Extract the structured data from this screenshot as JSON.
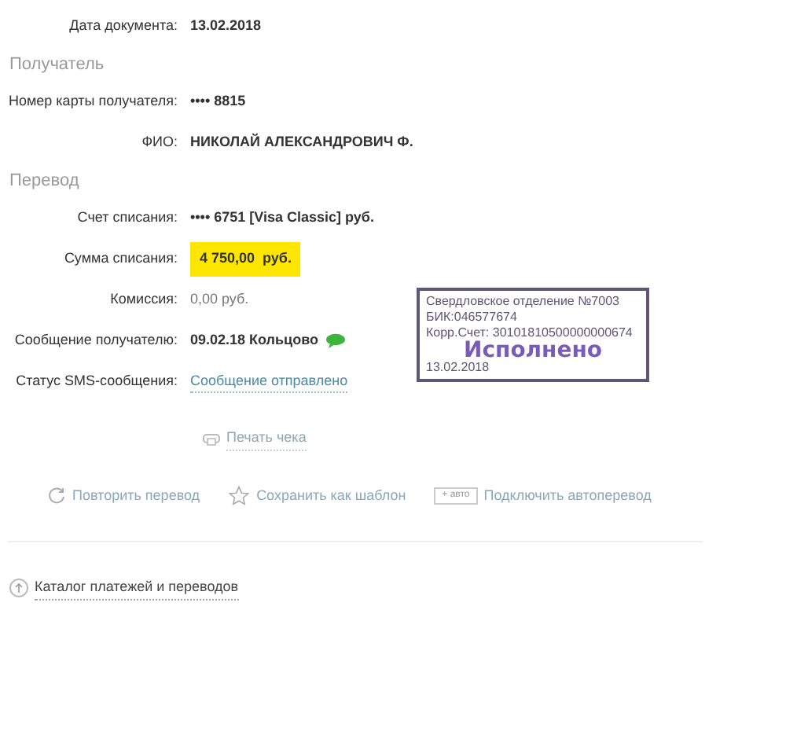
{
  "document_date": {
    "label": "Дата документа:",
    "value": "13.02.2018"
  },
  "sections": [
    {
      "title": "Получатель",
      "rows": [
        {
          "label": "Номер карты получателя:",
          "value": "•••• 8815",
          "kind": "bold"
        },
        {
          "label": "ФИО:",
          "value": "НИКОЛАЙ АЛЕКСАНДРОВИЧ Ф.",
          "kind": "bold"
        }
      ]
    },
    {
      "title": "Перевод",
      "rows": [
        {
          "label": "Счет списания:",
          "value": "•••• 6751  [Visa Classic]  руб.",
          "kind": "bold"
        },
        {
          "label": "Сумма списания:",
          "value": "4 750,00  руб.",
          "kind": "highlight"
        },
        {
          "label": "Комиссия:",
          "value": "0,00 руб.",
          "kind": "plain"
        },
        {
          "label": "Сообщение получателю:",
          "value": "09.02.18 Кольцово",
          "kind": "message"
        },
        {
          "label": "Статус SMS-сообщения:",
          "value": "Сообщение отправлено",
          "kind": "link"
        }
      ]
    }
  ],
  "stamp": {
    "lines": [
      "Свердловское отделение №7003",
      "БИК:046577674",
      "Корр.Счет: 30101810500000000674"
    ],
    "status": "Исполнено",
    "date": "13.02.2018"
  },
  "print_link": "Печать чека",
  "actions": [
    {
      "kind": "repeat",
      "label": "Повторить перевод"
    },
    {
      "kind": "template",
      "label": "Сохранить как шаблон"
    },
    {
      "kind": "auto",
      "badge": "+ авто",
      "label": "Подключить автоперевод"
    }
  ],
  "catalog_link": "Каталог платежей и переводов"
}
